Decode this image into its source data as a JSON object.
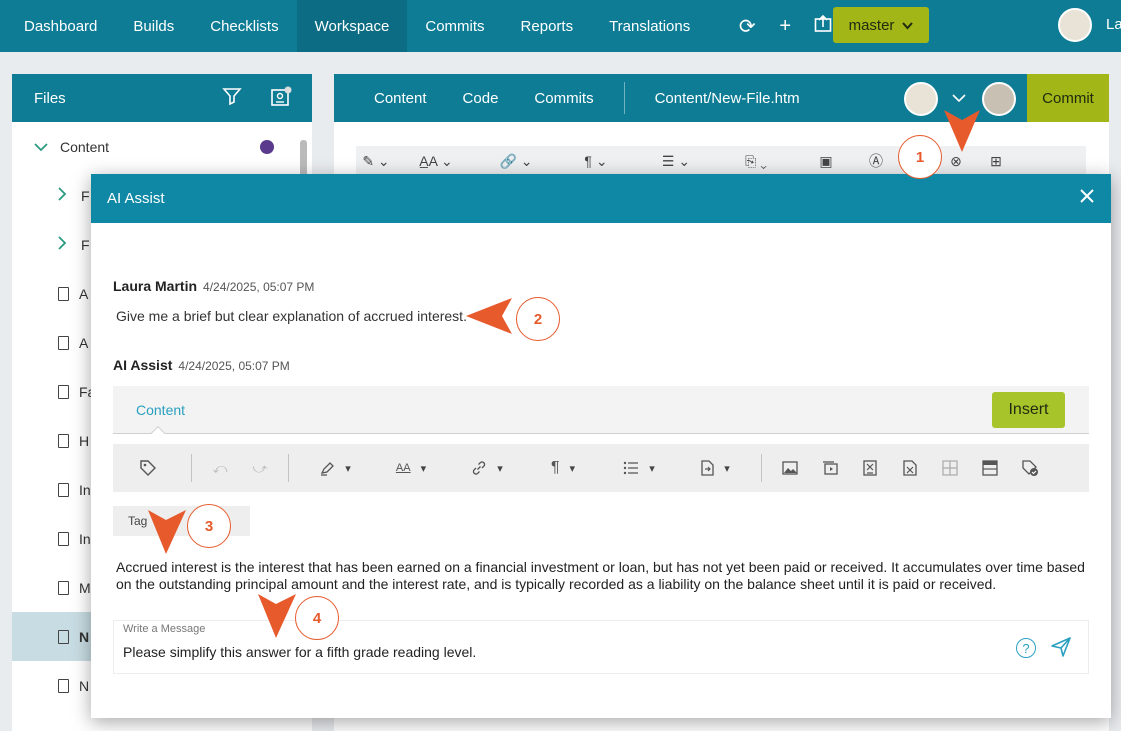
{
  "topnav": {
    "items": [
      "Dashboard",
      "Builds",
      "Checklists",
      "Workspace",
      "Commits",
      "Reports",
      "Translations"
    ],
    "branch": "master",
    "user": "La"
  },
  "files": {
    "title": "Files",
    "tree": [
      {
        "label": "Content"
      },
      {
        "label": "F"
      },
      {
        "label": "F"
      },
      {
        "label": "A"
      },
      {
        "label": "A"
      },
      {
        "label": "Fa"
      },
      {
        "label": "H"
      },
      {
        "label": "In"
      },
      {
        "label": "In"
      },
      {
        "label": "M"
      },
      {
        "label": "N"
      },
      {
        "label": "N"
      }
    ]
  },
  "editor": {
    "tabs": [
      "Content",
      "Code",
      "Commits"
    ],
    "file_path": "Content/New-File.htm",
    "commit_label": "Commit"
  },
  "modal": {
    "title": "AI Assist",
    "user_message": {
      "author": "Laura Martin",
      "time": "4/24/2025, 05:07 PM",
      "text": "Give me a brief but clear explanation of accrued interest."
    },
    "ai_message": {
      "author": "AI Assist",
      "time": "4/24/2025, 05:07 PM"
    },
    "response_tab": "Content",
    "insert_label": "Insert",
    "tag_label": "Tag",
    "tag_label_end": "o",
    "response_text": "Accrued interest is the interest that has been earned on a financial investment or loan, but has not yet been paid or received. It accumulates over time based on the outstanding principal amount and the interest rate, and is typically recorded as a liability on the balance sheet until it is paid or received.",
    "message_placeholder": "Write a Message",
    "message_value": "Please simplify this answer for a fifth grade reading level."
  },
  "callouts": [
    "1",
    "2",
    "3",
    "4"
  ],
  "colors": {
    "brand": "#0e7c95",
    "modal_header": "#0e88a5",
    "accent_green": "#a8c42b",
    "callout": "#e65a2b"
  }
}
